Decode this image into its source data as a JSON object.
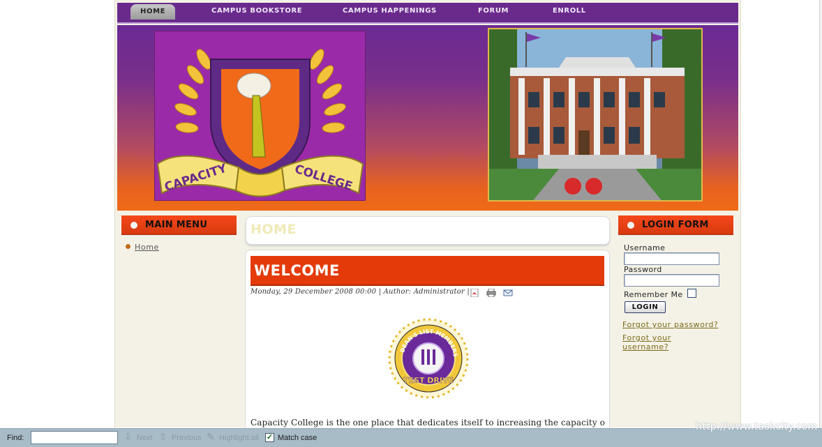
{
  "nav": {
    "items": [
      "HOME",
      "CAMPUS BOOKSTORE",
      "CAMPUS HAPPENINGS",
      "FORUM",
      "ENROLL"
    ]
  },
  "logo": {
    "left_text": "CAPACITY",
    "right_text": "COLLEGE"
  },
  "main_menu": {
    "title": "MAIN MENU",
    "items": [
      "Home"
    ]
  },
  "content": {
    "section_title": "HOME",
    "article_title": "WELCOME",
    "meta": "Monday, 29 December 2008 00:00 | Author: Administrator |",
    "badge_top_text": "DEAN'S LIST MEMBERSHIP",
    "badge_bottom_text": "TEST DRIVE",
    "intro": "Capacity College is the one place that dedicates itself to increasing the capacity of"
  },
  "login": {
    "title": "LOGIN FORM",
    "username_label": "Username",
    "password_label": "Password",
    "remember_label": "Remember Me",
    "button_label": "LOGIN",
    "forgot_password": "Forgot your password?",
    "forgot_username": "Forgot your username?"
  },
  "watermark": "http://www.taskcity.com",
  "findbar": {
    "label": "Find:",
    "next": "Next",
    "previous": "Previous",
    "highlight_all": "Highlight all",
    "match_case": "Match case",
    "match_case_checked": true
  },
  "colors": {
    "nav_bg": "#6a2a8c",
    "accent_orange": "#e43a0a",
    "module_head": "#f5471a"
  }
}
